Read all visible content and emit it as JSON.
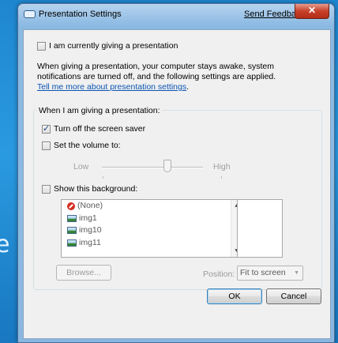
{
  "background_text": "e",
  "window": {
    "title": "Presentation Settings",
    "feedback_link": "Send Feedback",
    "close_label": "✕"
  },
  "presenting": {
    "label": "I am currently giving a presentation",
    "checked": false
  },
  "description": {
    "text": "When giving a presentation, your computer stays awake, system notifications are turned off, and the following settings are applied.",
    "link": "Tell me more about presentation settings"
  },
  "group": {
    "title": "When I am giving a presentation:",
    "screensaver": {
      "label": "Turn off the screen saver",
      "checked": true
    },
    "volume": {
      "label": "Set the volume to:",
      "checked": false,
      "low": "Low",
      "high": "High",
      "level": 0.55
    },
    "background": {
      "label": "Show this background:",
      "checked": false,
      "items": [
        {
          "icon": "none-icon",
          "label": "(None)"
        },
        {
          "icon": "image-icon",
          "label": "img1"
        },
        {
          "icon": "image-icon",
          "label": "img10"
        },
        {
          "icon": "image-icon",
          "label": "img11"
        }
      ]
    },
    "browse_label": "Browse...",
    "position_label": "Position:",
    "position_value": "Fit to screen"
  },
  "buttons": {
    "ok": "OK",
    "cancel": "Cancel"
  }
}
